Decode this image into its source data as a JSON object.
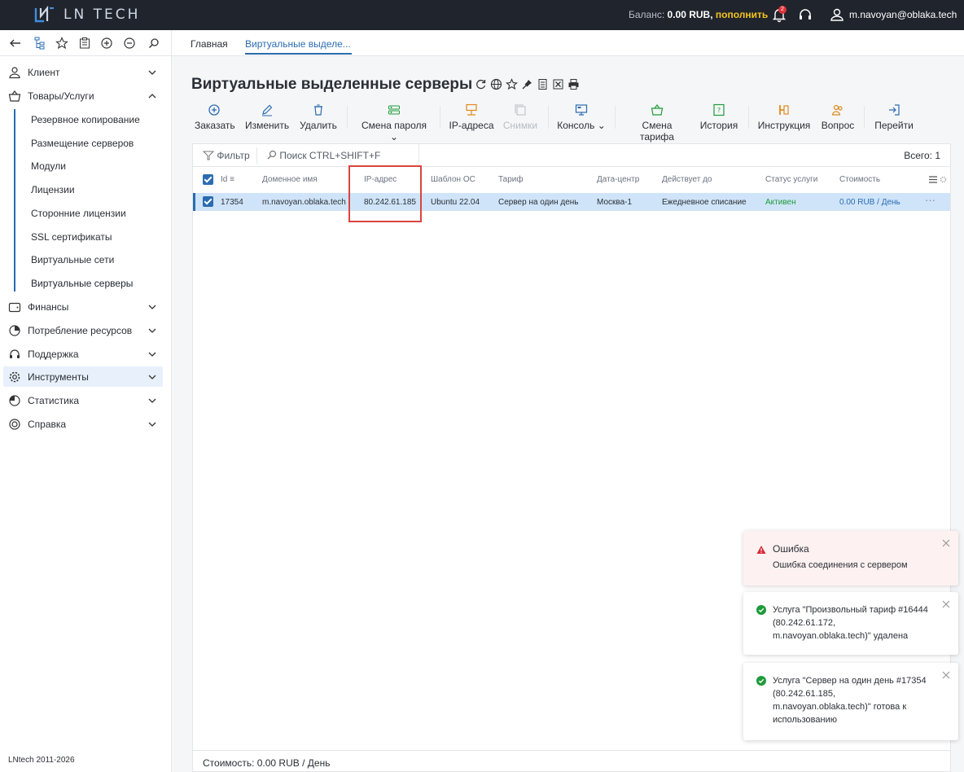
{
  "brand": {
    "name": "LN TECH"
  },
  "topbar": {
    "balance_label": "Баланс:",
    "balance_value": "0.00 RUB,",
    "topup_label": "пополнить",
    "notifications_count": "2",
    "user_email": "m.navoyan@oblaka.tech"
  },
  "tabs": [
    {
      "label": "Главная"
    },
    {
      "label": "Виртуальные выделе..."
    }
  ],
  "sidebar": {
    "items": [
      {
        "label": "Клиент"
      },
      {
        "label": "Товары/Услуги"
      },
      {
        "label": "Финансы"
      },
      {
        "label": "Потребление ресурсов"
      },
      {
        "label": "Поддержка"
      },
      {
        "label": "Инструменты"
      },
      {
        "label": "Статистика"
      },
      {
        "label": "Справка"
      }
    ],
    "subitems": [
      {
        "label": "Резервное копирование"
      },
      {
        "label": "Размещение серверов"
      },
      {
        "label": "Модули"
      },
      {
        "label": "Лицензии"
      },
      {
        "label": "Сторонние лицензии"
      },
      {
        "label": "SSL сертификаты"
      },
      {
        "label": "Виртуальные сети"
      },
      {
        "label": "Виртуальные серверы"
      }
    ],
    "copyright": "LNtech 2011-2026"
  },
  "page": {
    "title": "Виртуальные выделенные серверы"
  },
  "actions": [
    {
      "label": "Заказать"
    },
    {
      "label": "Изменить"
    },
    {
      "label": "Удалить"
    },
    {
      "label": "Смена пароля"
    },
    {
      "label": "IP-адреса"
    },
    {
      "label": "Снимки"
    },
    {
      "label": "Консоль"
    },
    {
      "label": "Смена тарифа"
    },
    {
      "label": "История"
    },
    {
      "label": "Инструкция"
    },
    {
      "label": "Вопрос"
    },
    {
      "label": "Перейти"
    }
  ],
  "table": {
    "filter_label": "Фильтр",
    "search_placeholder": "Поиск CTRL+SHIFT+F",
    "total": "Всего: 1",
    "headers": {
      "id": "Id",
      "domain": "Доменное имя",
      "ip": "IP-адрес",
      "os": "Шаблон ОС",
      "tariff": "Тариф",
      "datacenter": "Дата-центр",
      "valid": "Действует до",
      "status": "Статус услуги",
      "cost": "Стоимость"
    },
    "row": {
      "id": "17354",
      "domain": "m.navoyan.oblaka.tech",
      "ip": "80.242.61.185",
      "os": "Ubuntu 22.04",
      "tariff": "Сервер на один день",
      "datacenter": "Москва-1",
      "valid": "Ежедневное списание",
      "status": "Активен",
      "cost": "0.00 RUB / День"
    },
    "footer": "Стоимость: 0.00 RUB / День"
  },
  "toasts": [
    {
      "title": "Ошибка",
      "text": "Ошибка соединения с сервером"
    },
    {
      "text": "Услуга \"Произвольный тариф #16444\n(80.242.61.172,\nm.navoyan.oblaka.tech)\" удалена"
    },
    {
      "text": "Услуга \"Сервер на один день #17354\n(80.242.61.185,\nm.navoyan.oblaka.tech)\" готова к\nиспользованию"
    }
  ]
}
